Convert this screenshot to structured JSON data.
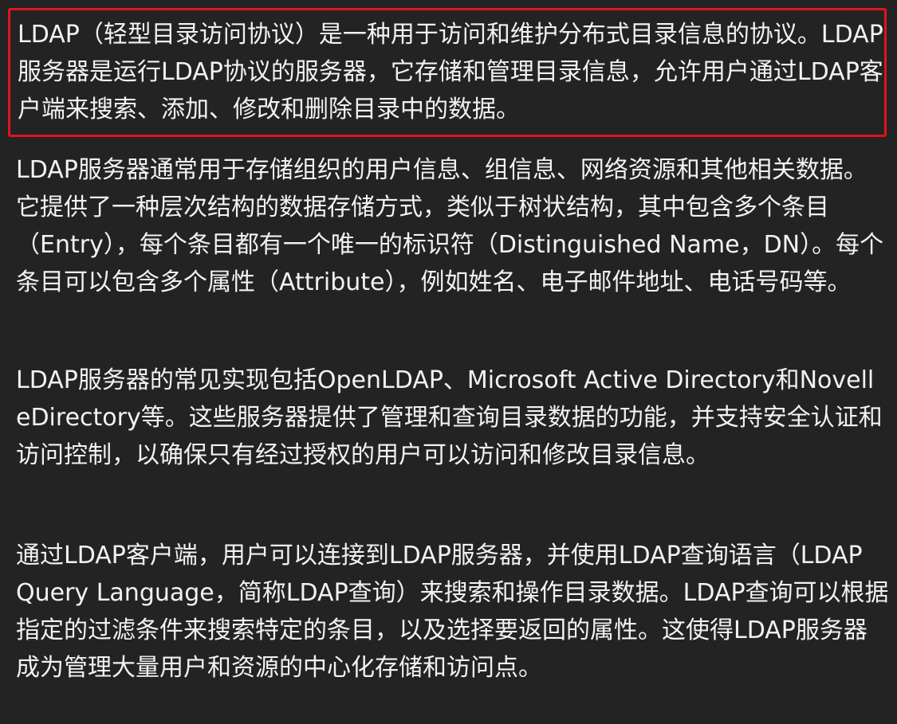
{
  "paragraphs": [
    "LDAP（轻型目录访问协议）是一种用于访问和维护分布式目录信息的协议。LDAP服务器是运行LDAP协议的服务器，它存储和管理目录信息，允许用户通过LDAP客户端来搜索、添加、修改和删除目录中的数据。",
    "LDAP服务器通常用于存储组织的用户信息、组信息、网络资源和其他相关数据。它提供了一种层次结构的数据存储方式，类似于树状结构，其中包含多个条目（Entry），每个条目都有一个唯一的标识符（Distinguished Name，DN）。每个条目可以包含多个属性（Attribute），例如姓名、电子邮件地址、电话号码等。",
    "LDAP服务器的常见实现包括OpenLDAP、Microsoft Active Directory和Novell eDirectory等。这些服务器提供了管理和查询目录数据的功能，并支持安全认证和访问控制，以确保只有经过授权的用户可以访问和修改目录信息。",
    "通过LDAP客户端，用户可以连接到LDAP服务器，并使用LDAP查询语言（LDAP Query Language，简称LDAP查询）来搜索和操作目录数据。LDAP查询可以根据指定的过滤条件来搜索特定的条目，以及选择要返回的属性。这使得LDAP服务器成为管理大量用户和资源的中心化存储和访问点。"
  ],
  "colors": {
    "background": "#232323",
    "text": "#f2f2f2",
    "highlight_border": "#e0141e"
  }
}
